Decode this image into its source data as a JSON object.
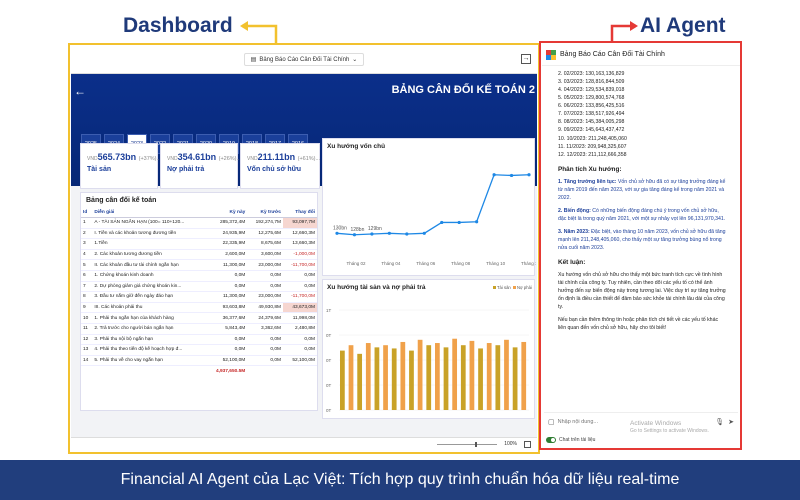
{
  "annotations": {
    "dashboard": "Dashboard",
    "agent": "AI Agent"
  },
  "dashboard": {
    "report_name": "Bảng Báo Cáo Cân Đối Tài Chính",
    "title": "BẢNG CÂN ĐỐI KẾ TOÁN 2",
    "years": [
      "2025",
      "2024",
      "2023",
      "2022",
      "2021",
      "2020",
      "2019",
      "2018",
      "2017",
      "2016"
    ],
    "active_year": "2023",
    "kpis": [
      {
        "prefix": "VND",
        "value": "565.73bn",
        "pct": "(+37%)...",
        "label": "Tài sản"
      },
      {
        "prefix": "VND",
        "value": "354.61bn",
        "pct": "(+26%)...",
        "label": "Nợ phải trả"
      },
      {
        "prefix": "VND",
        "value": "211.11bn",
        "pct": "(+61%)...",
        "label": "Vốn chủ sở hữu"
      }
    ],
    "table": {
      "title": "Bảng cân đối kế toán",
      "headers": [
        "Id",
        "Diễn giải",
        "Kỳ này",
        "Kỳ trước",
        "Thay đổi"
      ],
      "rows": [
        [
          "1",
          "A - TÀI SẢN NGẮN HẠN (100= 110+120...",
          "285,372,4M",
          "192,274,7M",
          "93,097,7M"
        ],
        [
          "2",
          "I. Tiền và các khoản tương đương tiền",
          "24,935,9M",
          "12,275,6M",
          "12,660,3M"
        ],
        [
          "3",
          "1.Tiền",
          "22,335,9M",
          "8,675,6M",
          "13,660,3M"
        ],
        [
          "4",
          "2. Các khoản tương đương tiền",
          "2,600,0M",
          "3,600,0M",
          "-1,000,0M"
        ],
        [
          "5",
          "II. Các khoản đầu tư tài chính ngắn hạn",
          "11,300,0M",
          "23,000,0M",
          "-11,700,0M"
        ],
        [
          "6",
          "1. Chứng khoán kinh doanh",
          "0,0M",
          "0,0M",
          "0,0M"
        ],
        [
          "7",
          "2. Dự phòng giảm giá chứng khoán kin...",
          "0,0M",
          "0,0M",
          "0,0M"
        ],
        [
          "8",
          "3. Đầu tư nắm giữ đến ngày đáo hạn",
          "11,300,0M",
          "23,000,0M",
          "-11,700,0M"
        ],
        [
          "9",
          "III. Các khoản phải thu",
          "93,603,8M",
          "49,930,8M",
          "43,673,0M"
        ],
        [
          "10",
          "1. Phải thu ngắn hạn của khách hàng",
          "36,377,6M",
          "24,379,6M",
          "11,998,0M"
        ],
        [
          "11",
          "2. Trả trước cho người bán ngắn hạn",
          "5,843,4M",
          "3,362,6M",
          "2,480,8M"
        ],
        [
          "12",
          "3. Phải thu nội bộ ngắn hạn",
          "0,0M",
          "0,0M",
          "0,0M"
        ],
        [
          "13",
          "4. Phải thu theo tiến độ kế hoạch hợp đ...",
          "0,0M",
          "0,0M",
          "0,0M"
        ],
        [
          "14",
          "5. Phải thu về cho vay ngắn hạn",
          "52,100,0M",
          "0,0M",
          "52,100,0M"
        ]
      ],
      "total": "4,937,650.5M"
    },
    "chart1": {
      "title": "Xu hướng vốn chủ"
    },
    "chart2": {
      "title": "Xu hướng tài sản và nợ phải trả",
      "legend": [
        "Tài sản",
        "Nợ phải"
      ]
    },
    "zoom": "100%"
  },
  "chart_data": [
    {
      "type": "line",
      "title": "Xu hướng vốn chủ",
      "x": [
        "Tháng 01",
        "Tháng 02",
        "Tháng 03",
        "Tháng 04",
        "Tháng 05",
        "Tháng 06",
        "Tháng 07",
        "Tháng 08",
        "Tháng 09",
        "Tháng 10",
        "Tháng 11",
        "Tháng 12"
      ],
      "x_labels_shown": [
        "Tháng 02",
        "Tháng 04",
        "Tháng 06",
        "Tháng 08",
        "Tháng 10",
        "Tháng 12"
      ],
      "values": [
        130,
        128,
        129,
        130,
        129,
        130,
        145,
        145,
        146,
        211,
        210,
        211
      ],
      "data_labels": [
        "130bn",
        "128bn",
        "129bn",
        "",
        "",
        "",
        "",
        "",
        "",
        "",
        "",
        ""
      ],
      "ylim": [
        100,
        230
      ]
    },
    {
      "type": "bar",
      "title": "Xu hướng tài sản và nợ phải trả",
      "y_ticks": [
        "1T",
        "0T",
        "0T",
        "0T",
        "0T"
      ],
      "series": [
        {
          "name": "Tài sản",
          "color": "#c9a227"
        },
        {
          "name": "Nợ phải",
          "color": "#f0a14a"
        }
      ],
      "ylim": [
        0,
        1
      ]
    }
  ],
  "agent": {
    "header": "Bảng Báo Cáo Cân Đối Tài Chính",
    "monthly": [
      "2. 02/2023: 130,163,136,829",
      "3. 03/2023: 128,816,844,509",
      "4. 04/2023: 129,534,839,018",
      "5. 05/2023: 129,800,574,768",
      "6. 06/2023: 133,856,425,516",
      "7. 07/2023: 138,517,926,494",
      "8. 08/2023: 145,384,005,298",
      "9. 09/2023: 145,643,437,472",
      "10. 10/2023: 211,248,405,060",
      "11. 11/2023: 209,948,325,607",
      "12. 12/2023: 211,112,666,358"
    ],
    "trend_heading": "Phân tích Xu hướng:",
    "trend": [
      {
        "b": "1. Tăng trưởng liên tục:",
        "t": " Vốn chủ sở hữu đã có sự tăng trưởng đáng kể từ năm 2019 đến năm 2023, với sự gia tăng đáng kể trong năm 2021 và 2022."
      },
      {
        "b": "2. Biến động:",
        "t": " Có những biến động đáng chú ý trong vốn chủ sở hữu, đặc biệt là trong quý năm 2021, với một sự nhảy vọt lên 96,131,970,341."
      },
      {
        "b": "3. Năm 2023:",
        "t": " Đặc biệt, vào tháng 10 năm 2023, vốn chủ sở hữu đã tăng mạnh lên 211,248,405,060, cho thấy một sự tăng trưởng bùng nổ trong nửa cuối năm 2023."
      }
    ],
    "conclusion_heading": "Kết luận:",
    "conclusion_1": "Xu hướng vốn chủ sở hữu cho thấy một bức tranh tích cực về tình hình tài chính của công ty. Tuy nhiên, cần theo dõi các yếu tố có thể ảnh hưởng đến sự biến động này trong tương lai. Việc duy trì sự tăng trưởng ổn định là điều cần thiết để đảm bảo sức khỏe tài chính lâu dài của công ty.",
    "conclusion_2": "Nếu bạn cần thêm thông tin hoặc phân tích chi tiết về các yếu tố khác liên quan đến vốn chủ sở hữu, hãy cho tôi biết!",
    "input_placeholder": "Nhập nội dung...",
    "watermark_1": "Activate Windows",
    "watermark_2": "Go to Settings to activate Windows.",
    "toggle_label": "Chat trên tài liệu"
  },
  "footer": "Financial AI Agent của Lạc Việt: Tích hợp quy trình chuẩn hóa dữ liệu real-time",
  "colors": {
    "banner": "#0b2f8a",
    "footer": "#213e7d",
    "dash_frame": "#f2c12e",
    "agent_frame": "#e53935",
    "line": "#1e88e5",
    "bar": "#c9a227"
  }
}
